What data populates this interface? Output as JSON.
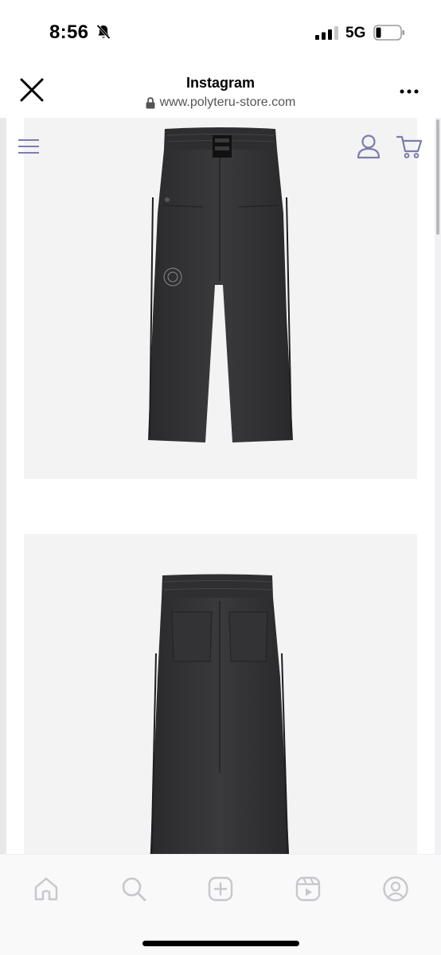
{
  "status_bar": {
    "time": "8:56",
    "network": "5G",
    "icons": [
      "bell-off-icon",
      "signal-icon",
      "battery-icon"
    ]
  },
  "browser": {
    "title": "Instagram",
    "url": "www.polyteru-store.com",
    "icons": [
      "close-icon",
      "lock-icon",
      "more-icon"
    ]
  },
  "site": {
    "icons": [
      "site-menu-icon",
      "account-icon",
      "cart-icon"
    ],
    "accent_color": "#7b7cae",
    "products": [
      {
        "view": "front",
        "icon": "pants-front-image"
      },
      {
        "view": "back",
        "icon": "pants-back-image"
      }
    ]
  },
  "tab_bar": {
    "items": [
      {
        "icon": "home-icon"
      },
      {
        "icon": "search-icon"
      },
      {
        "icon": "create-icon"
      },
      {
        "icon": "reels-icon"
      },
      {
        "icon": "profile-icon"
      }
    ],
    "icon_color": "#c7c7cc"
  }
}
